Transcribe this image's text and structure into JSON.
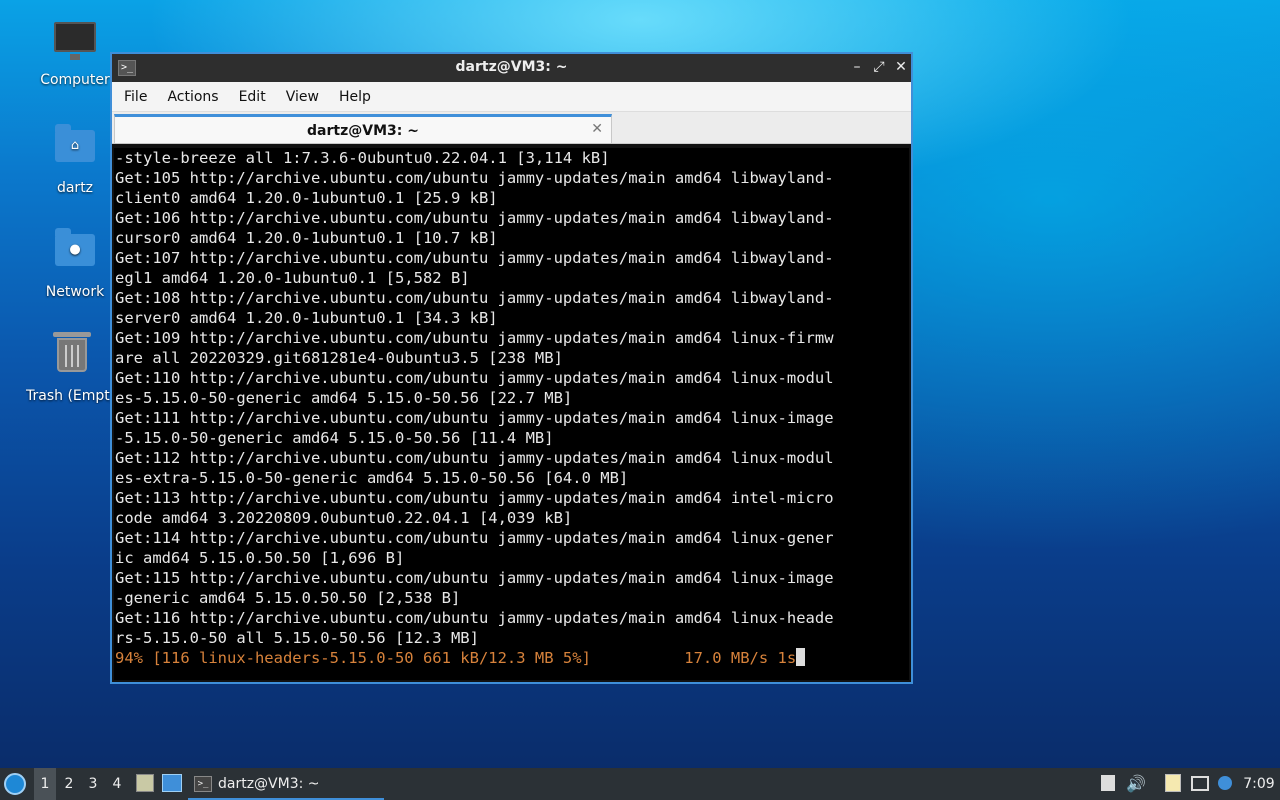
{
  "desktop": {
    "icons": [
      {
        "label": "Computer"
      },
      {
        "label": "dartz"
      },
      {
        "label": "Network"
      },
      {
        "label": "Trash (Empty)"
      }
    ]
  },
  "window": {
    "title": "dartz@VM3: ~",
    "menu": [
      "File",
      "Actions",
      "Edit",
      "View",
      "Help"
    ],
    "tab_label": "dartz@VM3: ~",
    "terminal_lines": [
      "-style-breeze all 1:7.3.6-0ubuntu0.22.04.1 [3,114 kB]",
      "Get:105 http://archive.ubuntu.com/ubuntu jammy-updates/main amd64 libwayland-",
      "client0 amd64 1.20.0-1ubuntu0.1 [25.9 kB]",
      "Get:106 http://archive.ubuntu.com/ubuntu jammy-updates/main amd64 libwayland-",
      "cursor0 amd64 1.20.0-1ubuntu0.1 [10.7 kB]",
      "Get:107 http://archive.ubuntu.com/ubuntu jammy-updates/main amd64 libwayland-",
      "egl1 amd64 1.20.0-1ubuntu0.1 [5,582 B]",
      "Get:108 http://archive.ubuntu.com/ubuntu jammy-updates/main amd64 libwayland-",
      "server0 amd64 1.20.0-1ubuntu0.1 [34.3 kB]",
      "Get:109 http://archive.ubuntu.com/ubuntu jammy-updates/main amd64 linux-firmw",
      "are all 20220329.git681281e4-0ubuntu3.5 [238 MB]",
      "Get:110 http://archive.ubuntu.com/ubuntu jammy-updates/main amd64 linux-modul",
      "es-5.15.0-50-generic amd64 5.15.0-50.56 [22.7 MB]",
      "Get:111 http://archive.ubuntu.com/ubuntu jammy-updates/main amd64 linux-image",
      "-5.15.0-50-generic amd64 5.15.0-50.56 [11.4 MB]",
      "Get:112 http://archive.ubuntu.com/ubuntu jammy-updates/main amd64 linux-modul",
      "es-extra-5.15.0-50-generic amd64 5.15.0-50.56 [64.0 MB]",
      "Get:113 http://archive.ubuntu.com/ubuntu jammy-updates/main amd64 intel-micro",
      "code amd64 3.20220809.0ubuntu0.22.04.1 [4,039 kB]",
      "Get:114 http://archive.ubuntu.com/ubuntu jammy-updates/main amd64 linux-gener",
      "ic amd64 5.15.0.50.50 [1,696 B]",
      "Get:115 http://archive.ubuntu.com/ubuntu jammy-updates/main amd64 linux-image",
      "-generic amd64 5.15.0.50.50 [2,538 B]",
      "Get:116 http://archive.ubuntu.com/ubuntu jammy-updates/main amd64 linux-heade",
      "rs-5.15.0-50 all 5.15.0-50.56 [12.3 MB]"
    ],
    "progress_line": "94% [116 linux-headers-5.15.0-50 661 kB/12.3 MB 5%]          17.0 MB/s 1s"
  },
  "taskbar": {
    "workspaces": [
      "1",
      "2",
      "3",
      "4"
    ],
    "task_label": "dartz@VM3: ~",
    "clock": "7:09"
  },
  "colors": {
    "accent": "#3f8fd9",
    "progress_text": "#d7823b"
  }
}
